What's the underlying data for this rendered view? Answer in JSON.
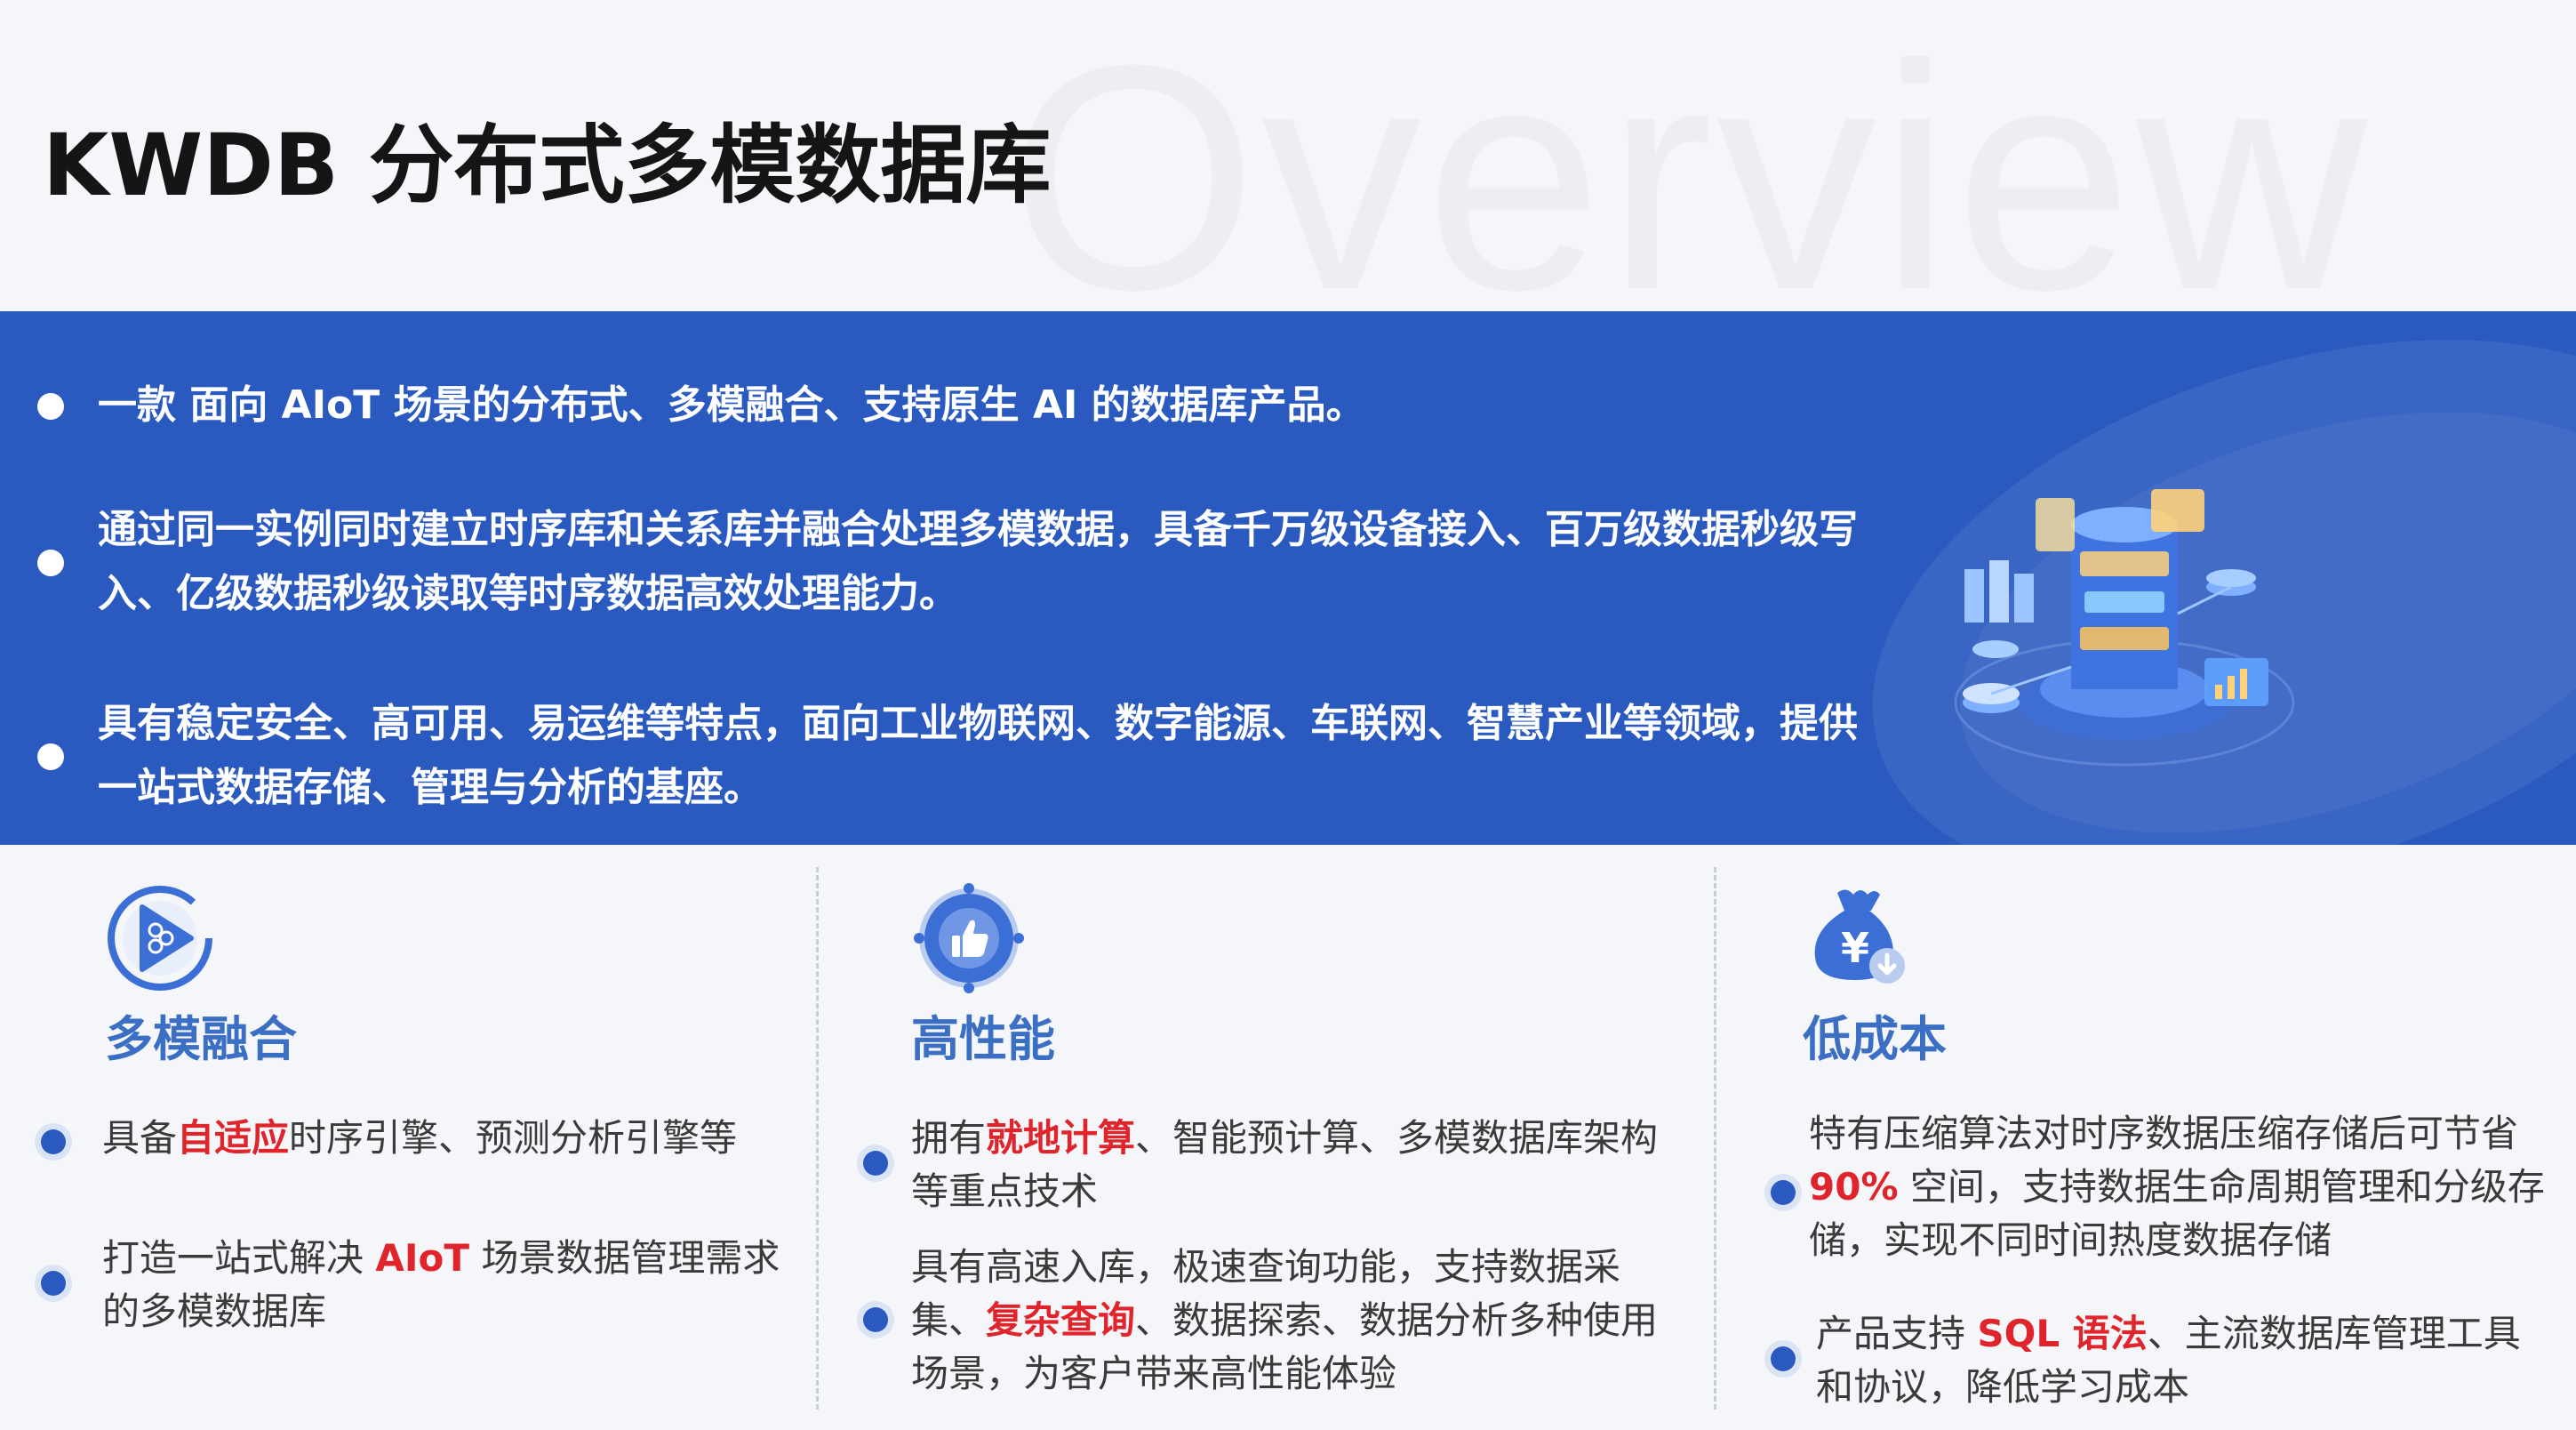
{
  "watermark": "Overview",
  "title": "KWDB 分布式多模数据库",
  "banner": {
    "bullets": [
      "一款  面向 AIoT 场景的分布式、多模融合、支持原生 AI 的数据库产品。",
      "通过同一实例同时建立时序库和关系库并融合处理多模数据，具备千万级设备接入、百万级数据秒级写入、亿级数据秒级读取等时序数据高效处理能力。",
      "具有稳定安全、高可用、易运维等特点，面向工业物联网、数字能源、车联网、智慧产业等领域，提供一站式数据存储、管理与分析的基座。"
    ]
  },
  "columns": [
    {
      "title": "多模融合",
      "icon": "multimodel-play-icon",
      "items": [
        {
          "before": "具备",
          "highlight": "自适应",
          "after": "时序引擎、预测分析引擎等"
        },
        {
          "before": "打造一站式解决 ",
          "highlight": "AIoT",
          "after": " 场景数据管理需求的多模数据库"
        }
      ]
    },
    {
      "title": "高性能",
      "icon": "thumbs-up-icon",
      "items": [
        {
          "before": "拥有",
          "highlight": "就地计算",
          "after": "、智能预计算、多模数据库架构等重点技术"
        },
        {
          "before": "具有高速入库，极速查询功能，支持数据采集、",
          "highlight": "复杂查询",
          "after": "、数据探索、数据分析多种使用场景，为客户带来高性能体验"
        }
      ]
    },
    {
      "title": "低成本",
      "icon": "money-bag-icon",
      "items": [
        {
          "before": "特有压缩算法对时序数据压缩存储后可节省 ",
          "highlight": "90%",
          "after": " 空间，支持数据生命周期管理和分级存储，实现不同时间热度数据存储"
        },
        {
          "before": "产品支持 ",
          "highlight": "SQL 语法",
          "after": "、主流数据库管理工具和协议，降低学习成本"
        }
      ]
    }
  ],
  "colors": {
    "banner": "#2a5ac0",
    "accent_title": "#3b6fc4",
    "highlight": "#e0242b"
  }
}
